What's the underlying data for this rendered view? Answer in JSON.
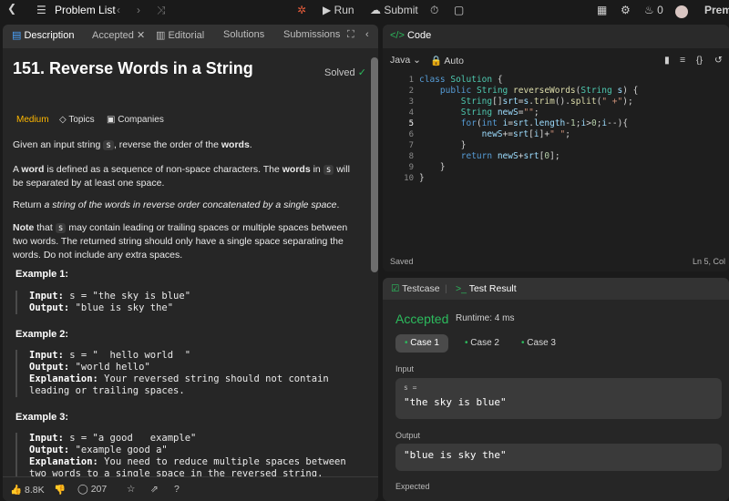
{
  "topbar": {
    "problem_list": "Problem List",
    "run": "Run",
    "submit": "Submit",
    "streak_count": "0",
    "premium": "Premi"
  },
  "left_tabs": {
    "description": "Description",
    "accepted": "Accepted",
    "editorial": "Editorial",
    "solutions": "Solutions",
    "submissions": "Submissions"
  },
  "problem": {
    "title": "151. Reverse Words in a String",
    "solved": "Solved",
    "difficulty": "Medium",
    "topics": "Topics",
    "companies": "Companies",
    "p1_a": "Given an input string ",
    "p1_code": "s",
    "p1_b": ", reverse the order of the ",
    "p1_bold": "words",
    "p1_c": ".",
    "p2_a": "A ",
    "p2_bold1": "word",
    "p2_b": " is defined as a sequence of non-space characters. The ",
    "p2_bold2": "words",
    "p2_c": " in ",
    "p2_code": "s",
    "p2_d": " will be separated by at least one space.",
    "p3_a": "Return ",
    "p3_ital": "a string of the words in reverse order concatenated by a single space",
    "p3_b": ".",
    "p4_bold": "Note",
    "p4_a": " that ",
    "p4_code": "s",
    "p4_b": " may contain leading or trailing spaces or multiple spaces between two words. The returned string should only have a single space separating the words. Do not include any extra spaces."
  },
  "examples": [
    {
      "heading": "Example 1:",
      "input_label": "Input:",
      "input": " s = \"the sky is blue\"",
      "output_label": "Output:",
      "output": " \"blue is sky the\""
    },
    {
      "heading": "Example 2:",
      "input_label": "Input:",
      "input": " s = \"  hello world  \"",
      "output_label": "Output:",
      "output": " \"world hello\"",
      "explanation_label": "Explanation:",
      "explanation": " Your reversed string should not contain leading or trailing spaces."
    },
    {
      "heading": "Example 3:",
      "input_label": "Input:",
      "input": " s = \"a good   example\"",
      "output_label": "Output:",
      "output": " \"example good a\"",
      "explanation_label": "Explanation:",
      "explanation": " You need to reduce multiple spaces between two words to a single space in the reversed string."
    }
  ],
  "left_bottom": {
    "likes": "8.8K",
    "comments": "207"
  },
  "code_panel": {
    "title": "Code",
    "language": "Java",
    "auto": "Auto",
    "saved": "Saved",
    "cursor": "Ln 5, Col",
    "line_numbers": [
      "1",
      "2",
      "3",
      "4",
      "5",
      "6",
      "7",
      "8",
      "9",
      "10"
    ]
  },
  "test_panel": {
    "testcase_tab": "Testcase",
    "result_tab": "Test Result",
    "status": "Accepted",
    "runtime": "Runtime: 4 ms",
    "cases": [
      "Case 1",
      "Case 2",
      "Case 3"
    ],
    "input_label": "Input",
    "input_var": "s =",
    "input_value": "\"the sky is blue\"",
    "output_label": "Output",
    "output_value": "\"blue is sky the\"",
    "expected_label": "Expected"
  },
  "colors": {
    "accent": "#ffa116",
    "success": "#2cbb5d",
    "medium": "#ffb800"
  }
}
